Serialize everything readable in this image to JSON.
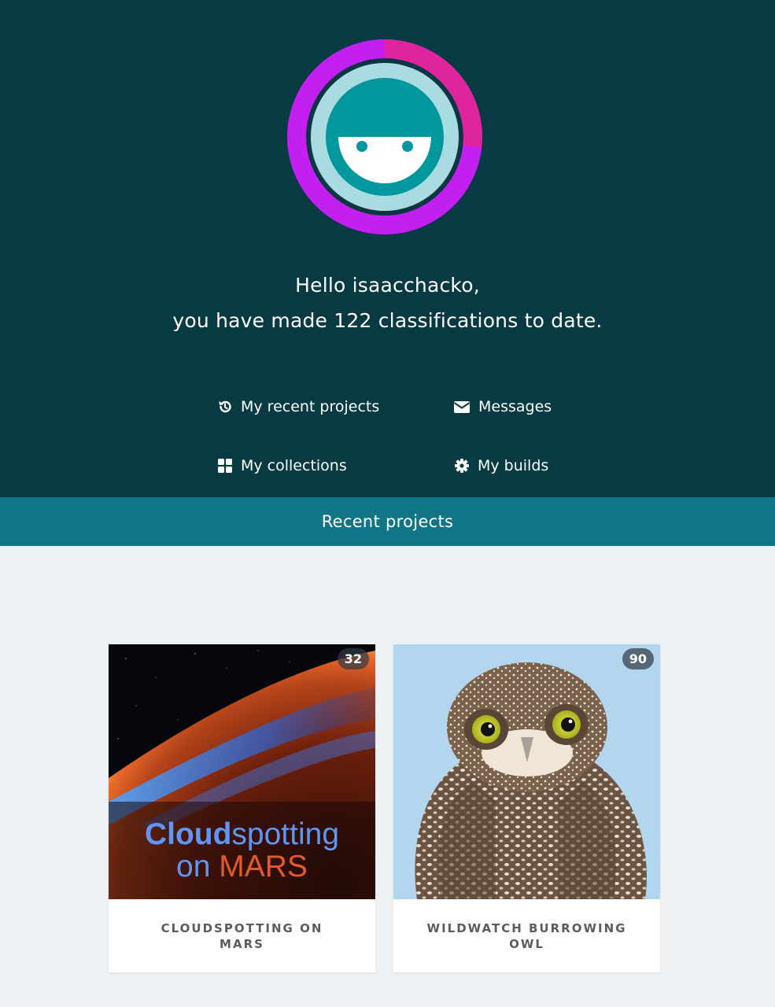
{
  "greeting": {
    "line1": "Hello isaacchacko,",
    "line2": "you have made 122 classifications to date."
  },
  "nav": {
    "recent_projects": {
      "label": "My recent projects",
      "icon": "history-icon"
    },
    "messages": {
      "label": "Messages",
      "icon": "envelope-icon"
    },
    "collections": {
      "label": "My collections",
      "icon": "grid-icon"
    },
    "builds": {
      "label": "My builds",
      "icon": "gear-icon"
    }
  },
  "section": {
    "title": "Recent projects"
  },
  "projects": [
    {
      "title": "CLOUDSPOTTING ON MARS",
      "count": "32",
      "image_text_bold": "Cloud",
      "image_text_rest": "spotting",
      "image_text_on": "on",
      "image_text_mars": "MARS"
    },
    {
      "title": "WILDWATCH BURROWING OWL",
      "count": "90"
    }
  ],
  "colors": {
    "hero_bg": "#073a42",
    "section_bar": "#117585",
    "page_bg": "#eef1f4",
    "ring_purple": "#c21ff0",
    "ring_pink": "#e0249e",
    "avatar_teal": "#00979d"
  }
}
